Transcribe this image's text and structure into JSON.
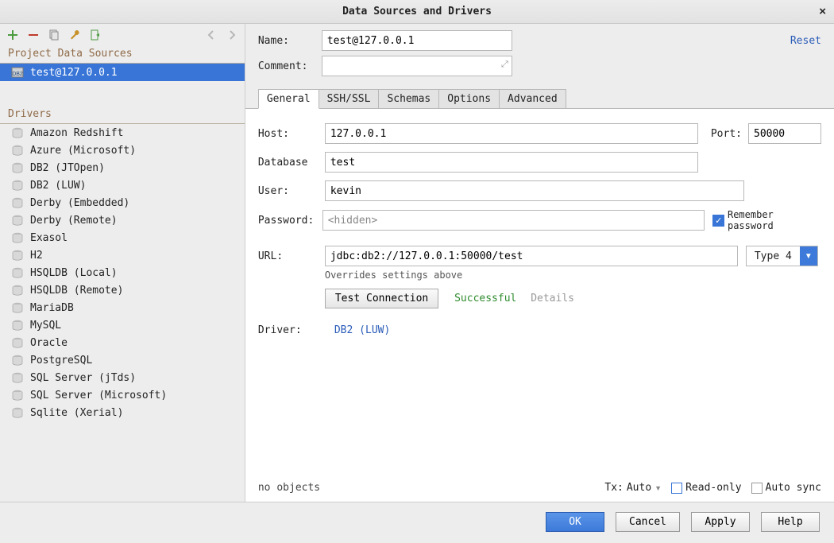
{
  "window": {
    "title": "Data Sources and Drivers"
  },
  "sidebar": {
    "section_ds": "Project Data Sources",
    "section_drv": "Drivers",
    "ds": {
      "0": {
        "label": "test@127.0.0.1"
      }
    },
    "drv": [
      "Amazon Redshift",
      "Azure (Microsoft)",
      "DB2 (JTOpen)",
      "DB2 (LUW)",
      "Derby (Embedded)",
      "Derby (Remote)",
      "Exasol",
      "H2",
      "HSQLDB (Local)",
      "HSQLDB (Remote)",
      "MariaDB",
      "MySQL",
      "Oracle",
      "PostgreSQL",
      "SQL Server (jTds)",
      "SQL Server (Microsoft)",
      "Sqlite (Xerial)"
    ]
  },
  "form": {
    "name_lbl": "Name:",
    "name_val": "test@127.0.0.1",
    "comment_lbl": "Comment:",
    "reset": "Reset",
    "tabs": [
      "General",
      "SSH/SSL",
      "Schemas",
      "Options",
      "Advanced"
    ],
    "host_lbl": "Host:",
    "host_val": "127.0.0.1",
    "port_lbl": "Port:",
    "port_val": "50000",
    "db_lbl": "Database",
    "db_val": "test",
    "user_lbl": "User:",
    "user_val": "kevin",
    "pass_lbl": "Password:",
    "pass_val": "<hidden>",
    "remember_lbl": "Remember password",
    "url_lbl": "URL:",
    "url_val": "jdbc:db2://127.0.0.1:50000/test",
    "url_hint": "Overrides settings above",
    "type_val": "Type 4",
    "test_btn": "Test Connection",
    "test_result": "Successful",
    "details": "Details",
    "driver_lbl": "Driver:",
    "driver_val": "DB2 (LUW)",
    "no_obj": "no objects",
    "tx_lbl": "Tx:",
    "tx_val": "Auto",
    "readonly_lbl": "Read-only",
    "autosync_lbl": "Auto sync"
  },
  "buttons": {
    "ok": "OK",
    "cancel": "Cancel",
    "apply": "Apply",
    "help": "Help"
  }
}
